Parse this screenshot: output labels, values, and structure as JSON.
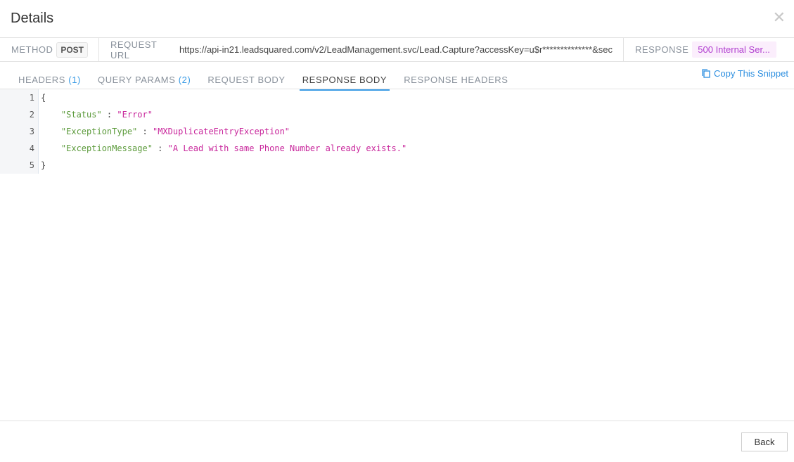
{
  "title": "Details",
  "meta": {
    "method_label": "METHOD",
    "method": "POST",
    "url_label": "REQUEST URL",
    "url": "https://api-in21.leadsquared.com/v2/LeadManagement.svc/Lead.Capture?accessKey=u$r**************&sec",
    "response_label": "RESPONSE",
    "response": "500 Internal Ser..."
  },
  "tabs": [
    {
      "label": "HEADERS",
      "count": "(1)"
    },
    {
      "label": "QUERY PARAMS",
      "count": "(2)"
    },
    {
      "label": "REQUEST BODY"
    },
    {
      "label": "RESPONSE BODY",
      "active": true
    },
    {
      "label": "RESPONSE HEADERS"
    }
  ],
  "copy_label": "Copy This Snippet",
  "code": {
    "lines": [
      "1",
      "2",
      "3",
      "4",
      "5"
    ],
    "open": "{",
    "close": "}",
    "fields": [
      {
        "key": "\"Status\"",
        "value": "\"Error\""
      },
      {
        "key": "\"ExceptionType\"",
        "value": "\"MXDuplicateEntryException\""
      },
      {
        "key": "\"ExceptionMessage\"",
        "value": "\"A Lead with same Phone Number already exists.\""
      }
    ],
    "sep": " : "
  },
  "back_label": "Back",
  "colors": {
    "accent": "#3a9be5",
    "key": "#5b9a3a",
    "string": "#c8259b",
    "status_bg": "#fbeefc"
  }
}
